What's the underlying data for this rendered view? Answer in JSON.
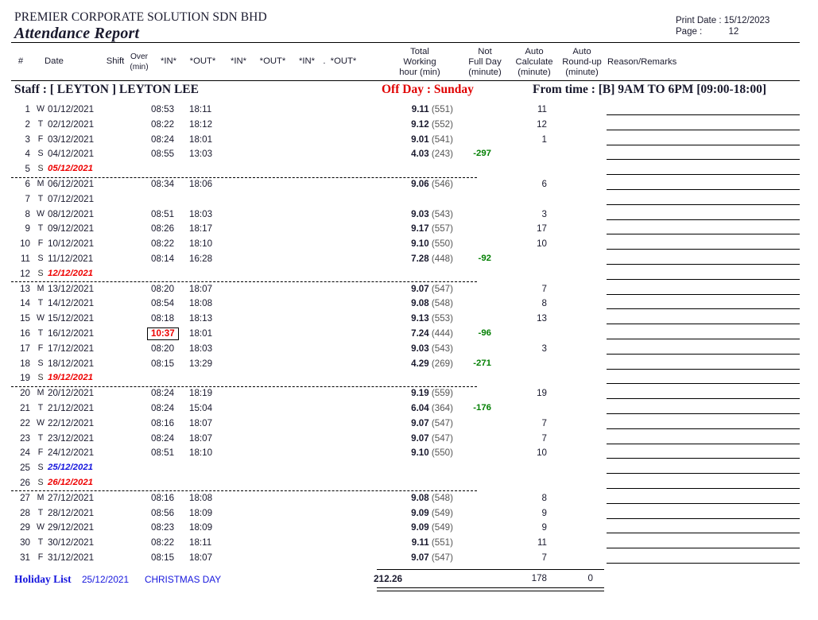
{
  "header": {
    "company": "PREMIER CORPORATE SOLUTION SDN BHD",
    "report_title": "Attendance Report",
    "print_date_label": "Print Date :",
    "print_date_value": "15/12/2023",
    "page_label": "Page :",
    "page_value": "12"
  },
  "columns": {
    "num": "#",
    "date": "Date",
    "shift": "Shift",
    "over_l1": "Over",
    "over_l2": "(min)",
    "in1": "*IN*",
    "out1": "*OUT*",
    "in2": "*IN*",
    "out2": "*OUT*",
    "in3": "*IN*",
    "out3_prefix": ".",
    "out3": "*OUT*",
    "total_l1": "Total",
    "total_l2": "Working",
    "total_l3": "hour (min)",
    "notfull_l1": "Not",
    "notfull_l2": "Full Day",
    "notfull_l3": "(minute)",
    "autocalc_l1": "Auto",
    "autocalc_l2": "Calculate",
    "autocalc_l3": "(minute)",
    "autoround_l1": "Auto",
    "autoround_l2": "Round-up",
    "autoround_l3": "(minute)",
    "reason": "Reason/Remarks"
  },
  "staff": {
    "label": "Staff :  [ LEYTON ]  LEYTON LEE",
    "off_day": "Off Day : Sunday",
    "from_time": "From time : [B] 9AM TO 6PM [09:00-18:00]"
  },
  "rows": [
    {
      "num": "1",
      "dow": "W",
      "date": "01/12/2021",
      "shift": "",
      "over": "",
      "in1": "08:53",
      "out1": "18:11",
      "total_h": "9.11",
      "total_m": "(551)",
      "notfull": "",
      "autocalc": "11",
      "autoround": "",
      "remark": "",
      "kind": "normal",
      "sep": false
    },
    {
      "num": "2",
      "dow": "T",
      "date": "02/12/2021",
      "shift": "",
      "over": "",
      "in1": "08:22",
      "out1": "18:12",
      "total_h": "9.12",
      "total_m": "(552)",
      "notfull": "",
      "autocalc": "12",
      "autoround": "",
      "remark": "",
      "kind": "normal",
      "sep": false
    },
    {
      "num": "3",
      "dow": "F",
      "date": "03/12/2021",
      "shift": "",
      "over": "",
      "in1": "08:24",
      "out1": "18:01",
      "total_h": "9.01",
      "total_m": "(541)",
      "notfull": "",
      "autocalc": "1",
      "autoround": "",
      "remark": "",
      "kind": "normal",
      "sep": false
    },
    {
      "num": "4",
      "dow": "S",
      "date": "04/12/2021",
      "shift": "",
      "over": "",
      "in1": "08:55",
      "out1": "13:03",
      "total_h": "4.03",
      "total_m": "(243)",
      "notfull": "-297",
      "autocalc": "",
      "autoround": "",
      "remark": "",
      "kind": "normal",
      "sep": false
    },
    {
      "num": "5",
      "dow": "S",
      "date": "05/12/2021",
      "shift": "",
      "over": "",
      "in1": "",
      "out1": "",
      "total_h": "",
      "total_m": "",
      "notfull": "",
      "autocalc": "",
      "autoround": "",
      "remark": "",
      "kind": "offday",
      "sep": true
    },
    {
      "num": "6",
      "dow": "M",
      "date": "06/12/2021",
      "shift": "",
      "over": "",
      "in1": "08:34",
      "out1": "18:06",
      "total_h": "9.06",
      "total_m": "(546)",
      "notfull": "",
      "autocalc": "6",
      "autoround": "",
      "remark": "",
      "kind": "normal",
      "sep": false
    },
    {
      "num": "7",
      "dow": "T",
      "date": "07/12/2021",
      "shift": "",
      "over": "",
      "in1": "",
      "out1": "",
      "total_h": "",
      "total_m": "",
      "notfull": "",
      "autocalc": "",
      "autoround": "",
      "remark": "",
      "kind": "normal",
      "sep": false
    },
    {
      "num": "8",
      "dow": "W",
      "date": "08/12/2021",
      "shift": "",
      "over": "",
      "in1": "08:51",
      "out1": "18:03",
      "total_h": "9.03",
      "total_m": "(543)",
      "notfull": "",
      "autocalc": "3",
      "autoround": "",
      "remark": "",
      "kind": "normal",
      "sep": false
    },
    {
      "num": "9",
      "dow": "T",
      "date": "09/12/2021",
      "shift": "",
      "over": "",
      "in1": "08:26",
      "out1": "18:17",
      "total_h": "9.17",
      "total_m": "(557)",
      "notfull": "",
      "autocalc": "17",
      "autoround": "",
      "remark": "",
      "kind": "normal",
      "sep": false
    },
    {
      "num": "10",
      "dow": "F",
      "date": "10/12/2021",
      "shift": "",
      "over": "",
      "in1": "08:22",
      "out1": "18:10",
      "total_h": "9.10",
      "total_m": "(550)",
      "notfull": "",
      "autocalc": "10",
      "autoround": "",
      "remark": "",
      "kind": "normal",
      "sep": false
    },
    {
      "num": "11",
      "dow": "S",
      "date": "11/12/2021",
      "shift": "",
      "over": "",
      "in1": "08:14",
      "out1": "16:28",
      "total_h": "7.28",
      "total_m": "(448)",
      "notfull": "-92",
      "autocalc": "",
      "autoround": "",
      "remark": "",
      "kind": "normal",
      "sep": false
    },
    {
      "num": "12",
      "dow": "S",
      "date": "12/12/2021",
      "shift": "",
      "over": "",
      "in1": "",
      "out1": "",
      "total_h": "",
      "total_m": "",
      "notfull": "",
      "autocalc": "",
      "autoround": "",
      "remark": "",
      "kind": "offday",
      "sep": true
    },
    {
      "num": "13",
      "dow": "M",
      "date": "13/12/2021",
      "shift": "",
      "over": "",
      "in1": "08:20",
      "out1": "18:07",
      "total_h": "9.07",
      "total_m": "(547)",
      "notfull": "",
      "autocalc": "7",
      "autoround": "",
      "remark": "",
      "kind": "normal",
      "sep": false
    },
    {
      "num": "14",
      "dow": "T",
      "date": "14/12/2021",
      "shift": "",
      "over": "",
      "in1": "08:54",
      "out1": "18:08",
      "total_h": "9.08",
      "total_m": "(548)",
      "notfull": "",
      "autocalc": "8",
      "autoround": "",
      "remark": "",
      "kind": "normal",
      "sep": false
    },
    {
      "num": "15",
      "dow": "W",
      "date": "15/12/2021",
      "shift": "",
      "over": "",
      "in1": "08:18",
      "out1": "18:13",
      "total_h": "9.13",
      "total_m": "(553)",
      "notfull": "",
      "autocalc": "13",
      "autoround": "",
      "remark": "",
      "kind": "normal",
      "sep": false
    },
    {
      "num": "16",
      "dow": "T",
      "date": "16/12/2021",
      "shift": "",
      "over": "",
      "in1": "10:37",
      "out1": "18:01",
      "total_h": "7.24",
      "total_m": "(444)",
      "notfull": "-96",
      "autocalc": "",
      "autoround": "",
      "remark": "",
      "kind": "late",
      "sep": false
    },
    {
      "num": "17",
      "dow": "F",
      "date": "17/12/2021",
      "shift": "",
      "over": "",
      "in1": "08:20",
      "out1": "18:03",
      "total_h": "9.03",
      "total_m": "(543)",
      "notfull": "",
      "autocalc": "3",
      "autoround": "",
      "remark": "",
      "kind": "normal",
      "sep": false
    },
    {
      "num": "18",
      "dow": "S",
      "date": "18/12/2021",
      "shift": "",
      "over": "",
      "in1": "08:15",
      "out1": "13:29",
      "total_h": "4.29",
      "total_m": "(269)",
      "notfull": "-271",
      "autocalc": "",
      "autoround": "",
      "remark": "",
      "kind": "normal",
      "sep": false
    },
    {
      "num": "19",
      "dow": "S",
      "date": "19/12/2021",
      "shift": "",
      "over": "",
      "in1": "",
      "out1": "",
      "total_h": "",
      "total_m": "",
      "notfull": "",
      "autocalc": "",
      "autoround": "",
      "remark": "",
      "kind": "offday",
      "sep": true
    },
    {
      "num": "20",
      "dow": "M",
      "date": "20/12/2021",
      "shift": "",
      "over": "",
      "in1": "08:24",
      "out1": "18:19",
      "total_h": "9.19",
      "total_m": "(559)",
      "notfull": "",
      "autocalc": "19",
      "autoround": "",
      "remark": "",
      "kind": "normal",
      "sep": false
    },
    {
      "num": "21",
      "dow": "T",
      "date": "21/12/2021",
      "shift": "",
      "over": "",
      "in1": "08:24",
      "out1": "15:04",
      "total_h": "6.04",
      "total_m": "(364)",
      "notfull": "-176",
      "autocalc": "",
      "autoround": "",
      "remark": "",
      "kind": "normal",
      "sep": false
    },
    {
      "num": "22",
      "dow": "W",
      "date": "22/12/2021",
      "shift": "",
      "over": "",
      "in1": "08:16",
      "out1": "18:07",
      "total_h": "9.07",
      "total_m": "(547)",
      "notfull": "",
      "autocalc": "7",
      "autoround": "",
      "remark": "",
      "kind": "normal",
      "sep": false
    },
    {
      "num": "23",
      "dow": "T",
      "date": "23/12/2021",
      "shift": "",
      "over": "",
      "in1": "08:24",
      "out1": "18:07",
      "total_h": "9.07",
      "total_m": "(547)",
      "notfull": "",
      "autocalc": "7",
      "autoround": "",
      "remark": "",
      "kind": "normal",
      "sep": false
    },
    {
      "num": "24",
      "dow": "F",
      "date": "24/12/2021",
      "shift": "",
      "over": "",
      "in1": "08:51",
      "out1": "18:10",
      "total_h": "9.10",
      "total_m": "(550)",
      "notfull": "",
      "autocalc": "10",
      "autoround": "",
      "remark": "",
      "kind": "normal",
      "sep": false
    },
    {
      "num": "25",
      "dow": "S",
      "date": "25/12/2021",
      "shift": "",
      "over": "",
      "in1": "",
      "out1": "",
      "total_h": "",
      "total_m": "",
      "notfull": "",
      "autocalc": "",
      "autoround": "",
      "remark": "",
      "kind": "holiday",
      "sep": false
    },
    {
      "num": "26",
      "dow": "S",
      "date": "26/12/2021",
      "shift": "",
      "over": "",
      "in1": "",
      "out1": "",
      "total_h": "",
      "total_m": "",
      "notfull": "",
      "autocalc": "",
      "autoround": "",
      "remark": "",
      "kind": "offday",
      "sep": true
    },
    {
      "num": "27",
      "dow": "M",
      "date": "27/12/2021",
      "shift": "",
      "over": "",
      "in1": "08:16",
      "out1": "18:08",
      "total_h": "9.08",
      "total_m": "(548)",
      "notfull": "",
      "autocalc": "8",
      "autoround": "",
      "remark": "",
      "kind": "normal",
      "sep": false
    },
    {
      "num": "28",
      "dow": "T",
      "date": "28/12/2021",
      "shift": "",
      "over": "",
      "in1": "08:56",
      "out1": "18:09",
      "total_h": "9.09",
      "total_m": "(549)",
      "notfull": "",
      "autocalc": "9",
      "autoround": "",
      "remark": "",
      "kind": "normal",
      "sep": false
    },
    {
      "num": "29",
      "dow": "W",
      "date": "29/12/2021",
      "shift": "",
      "over": "",
      "in1": "08:23",
      "out1": "18:09",
      "total_h": "9.09",
      "total_m": "(549)",
      "notfull": "",
      "autocalc": "9",
      "autoround": "",
      "remark": "",
      "kind": "normal",
      "sep": false
    },
    {
      "num": "30",
      "dow": "T",
      "date": "30/12/2021",
      "shift": "",
      "over": "",
      "in1": "08:22",
      "out1": "18:11",
      "total_h": "9.11",
      "total_m": "(551)",
      "notfull": "",
      "autocalc": "11",
      "autoround": "",
      "remark": "",
      "kind": "normal",
      "sep": false
    },
    {
      "num": "31",
      "dow": "F",
      "date": "31/12/2021",
      "shift": "",
      "over": "",
      "in1": "08:15",
      "out1": "18:07",
      "total_h": "9.07",
      "total_m": "(547)",
      "notfull": "",
      "autocalc": "7",
      "autoround": "",
      "remark": "",
      "kind": "normal",
      "sep": false
    }
  ],
  "totals": {
    "total_working": "212.26",
    "auto_calculate": "178",
    "auto_roundup": "0"
  },
  "holiday_list": {
    "label": "Holiday List",
    "date": "25/12/2021",
    "name": "CHRISTMAS DAY"
  },
  "colors": {
    "offday_red": "#ee0000",
    "holiday_blue": "#1616dd",
    "negative_green": "#048004",
    "text": "#1a1a2e"
  }
}
